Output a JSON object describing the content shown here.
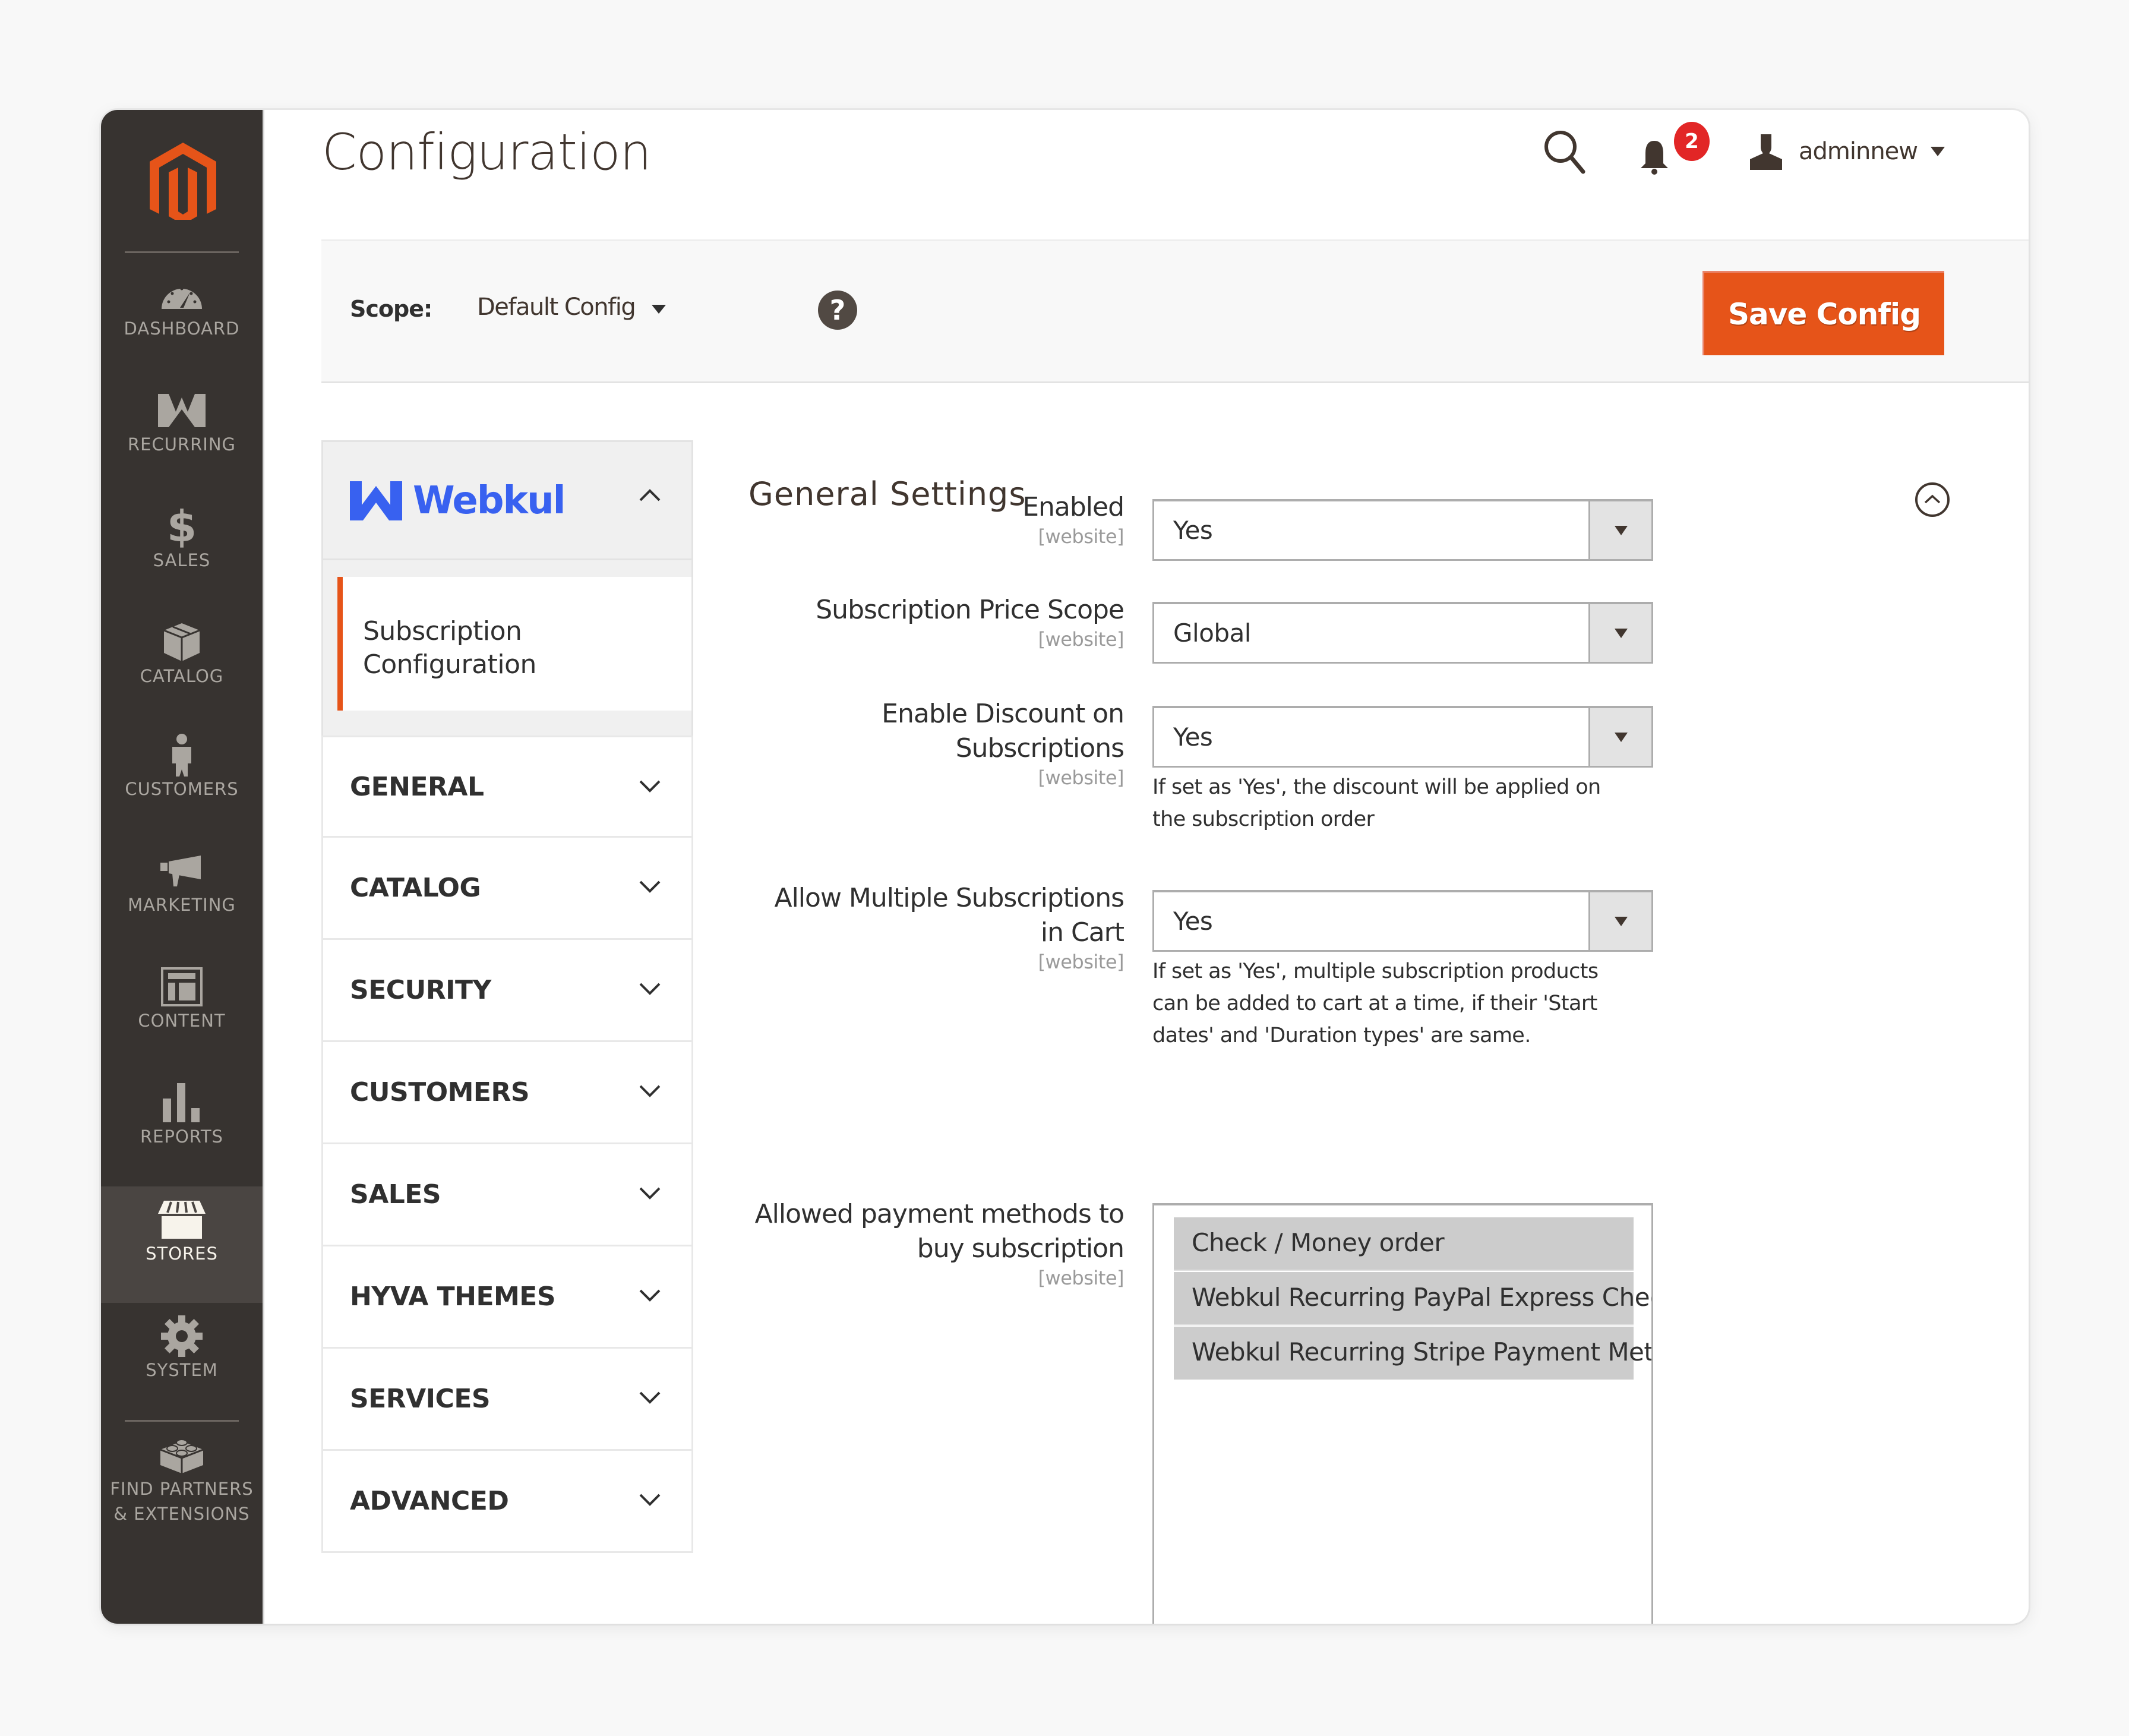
{
  "app": {
    "brand": "Magento",
    "page_title": "Configuration"
  },
  "colors": {
    "accent": "#e65419",
    "sidebar_bg": "#373330",
    "sidebar_active": "#4a4542",
    "webkul_blue": "#3861f0",
    "badge": "#e22626"
  },
  "sidebar": {
    "items": [
      {
        "label": "DASHBOARD",
        "icon": "dashboard-icon",
        "active": false
      },
      {
        "label": "RECURRING",
        "icon": "recurring-w-icon",
        "active": false
      },
      {
        "label": "SALES",
        "icon": "dollar-icon",
        "active": false
      },
      {
        "label": "CATALOG",
        "icon": "box-icon",
        "active": false
      },
      {
        "label": "CUSTOMERS",
        "icon": "person-icon",
        "active": false
      },
      {
        "label": "MARKETING",
        "icon": "megaphone-icon",
        "active": false
      },
      {
        "label": "CONTENT",
        "icon": "layout-icon",
        "active": false
      },
      {
        "label": "REPORTS",
        "icon": "bar-chart-icon",
        "active": false
      },
      {
        "label": "STORES",
        "icon": "store-icon",
        "active": true
      },
      {
        "label": "SYSTEM",
        "icon": "gear-icon",
        "active": false
      },
      {
        "label": "FIND PARTNERS",
        "label2": "& EXTENSIONS",
        "icon": "lego-brick-icon",
        "active": false
      }
    ]
  },
  "header": {
    "notifications_count": "2",
    "user_name": "adminnew"
  },
  "scope": {
    "label": "Scope:",
    "value": "Default Config",
    "help": "?",
    "save_label": "Save Config"
  },
  "leftnav": {
    "group_title": "Webkul",
    "active_item": {
      "line1": "Subscription",
      "line2": "Configuration"
    },
    "tabs": [
      "GENERAL",
      "CATALOG",
      "SECURITY",
      "CUSTOMERS",
      "SALES",
      "HYVA THEMES",
      "SERVICES",
      "ADVANCED"
    ]
  },
  "section": {
    "title": "General Settings",
    "fields": [
      {
        "label": [
          "Enabled"
        ],
        "scope": "[website]",
        "value": "Yes",
        "note": []
      },
      {
        "label": [
          "Subscription Price Scope"
        ],
        "scope": "[website]",
        "value": "Global",
        "note": []
      },
      {
        "label": [
          "Enable Discount on",
          "Subscriptions"
        ],
        "scope": "[website]",
        "value": "Yes",
        "note": [
          "If set as 'Yes', the discount will be applied on",
          "the subscription order"
        ]
      },
      {
        "label": [
          "Allow Multiple Subscriptions",
          "in Cart"
        ],
        "scope": "[website]",
        "value": "Yes",
        "note": [
          "If set as 'Yes', multiple subscription products",
          "can be added to cart at a time, if their 'Start",
          "dates' and 'Duration types' are same."
        ]
      }
    ],
    "payment": {
      "label": [
        "Allowed payment methods to",
        "buy subscription"
      ],
      "scope": "[website]",
      "options": [
        "Check / Money order",
        "Webkul Recurring PayPal Express Checkout",
        "Webkul Recurring Stripe Payment Method"
      ],
      "selected": [
        "Check / Money order",
        "Webkul Recurring PayPal Express Checkout",
        "Webkul Recurring Stripe Payment Method"
      ]
    }
  }
}
